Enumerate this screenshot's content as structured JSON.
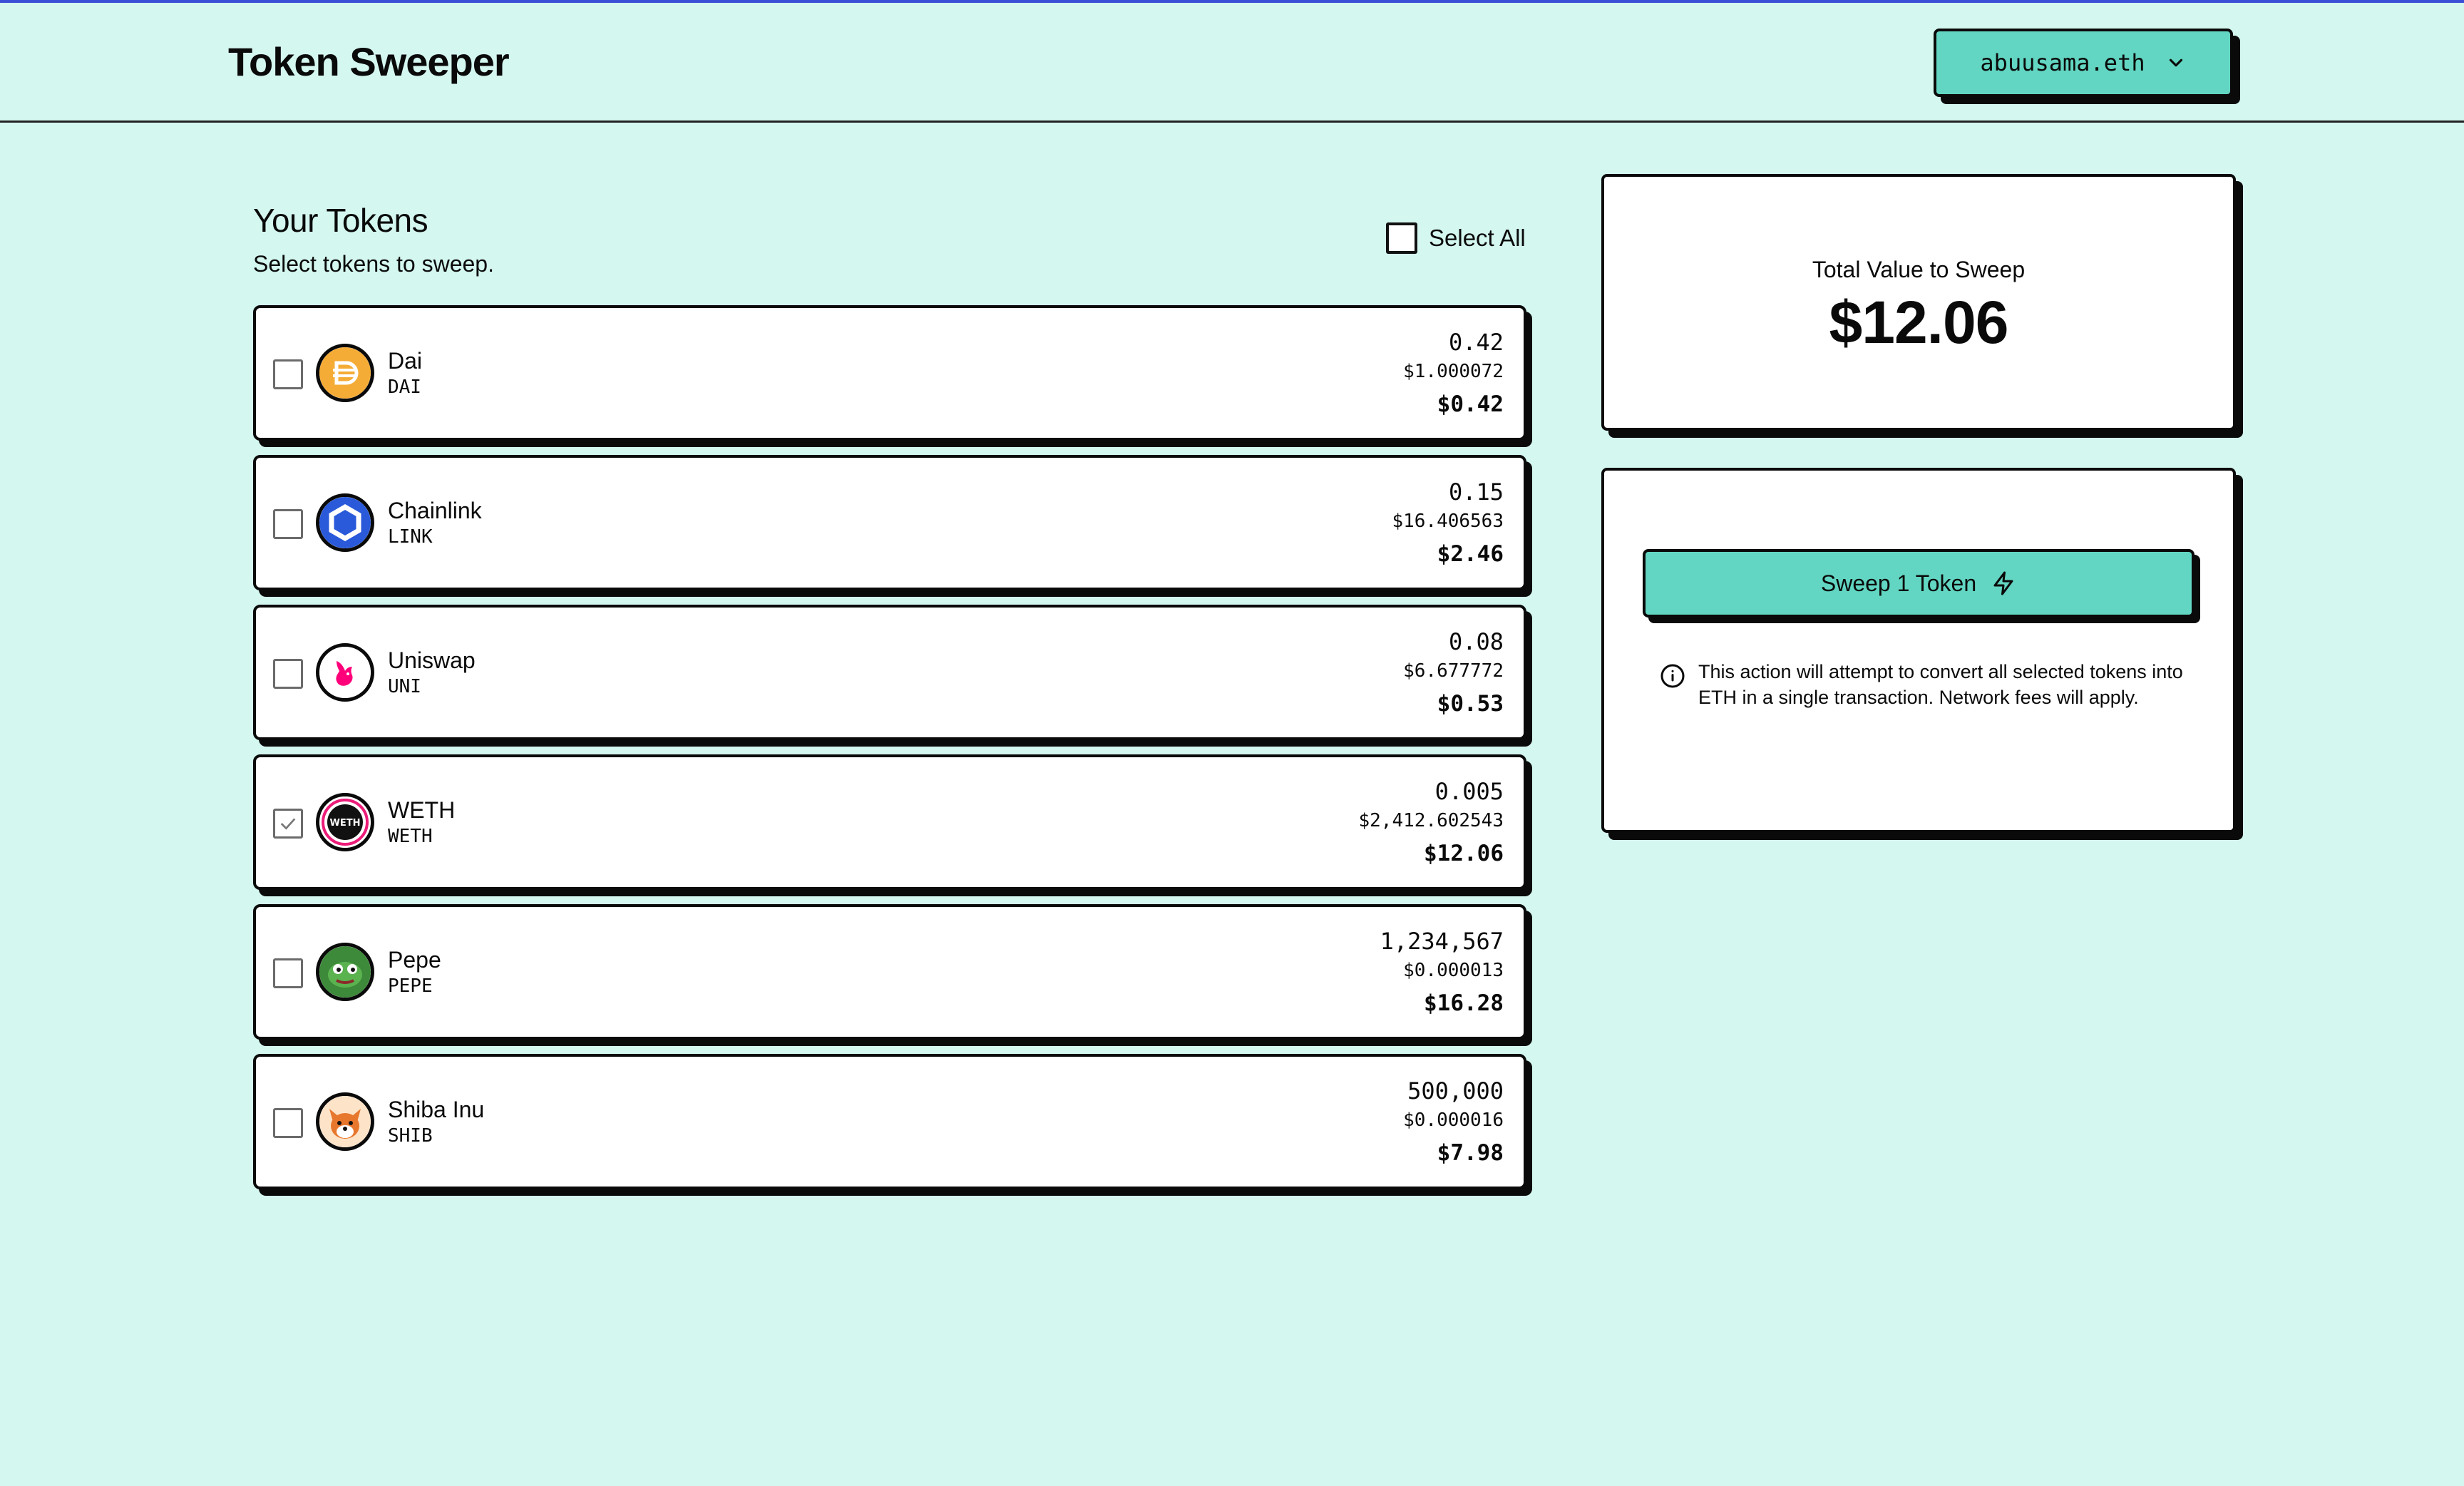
{
  "header": {
    "title": "Token Sweeper",
    "wallet": "abuusama.eth"
  },
  "tokens_section": {
    "title": "Your Tokens",
    "subtitle": "Select tokens to sweep.",
    "select_all_label": "Select All"
  },
  "tokens": [
    {
      "name": "Dai",
      "symbol": "DAI",
      "balance": "0.42",
      "price": "$1.000072",
      "value": "$0.42",
      "selected": false,
      "icon": "dai-icon"
    },
    {
      "name": "Chainlink",
      "symbol": "LINK",
      "balance": "0.15",
      "price": "$16.406563",
      "value": "$2.46",
      "selected": false,
      "icon": "chainlink-icon"
    },
    {
      "name": "Uniswap",
      "symbol": "UNI",
      "balance": "0.08",
      "price": "$6.677772",
      "value": "$0.53",
      "selected": false,
      "icon": "uniswap-icon"
    },
    {
      "name": "WETH",
      "symbol": "WETH",
      "balance": "0.005",
      "price": "$2,412.602543",
      "value": "$12.06",
      "selected": true,
      "icon": "weth-icon"
    },
    {
      "name": "Pepe",
      "symbol": "PEPE",
      "balance": "1,234,567",
      "price": "$0.000013",
      "value": "$16.28",
      "selected": false,
      "icon": "pepe-icon"
    },
    {
      "name": "Shiba Inu",
      "symbol": "SHIB",
      "balance": "500,000",
      "price": "$0.000016",
      "value": "$7.98",
      "selected": false,
      "icon": "shiba-inu-icon"
    }
  ],
  "summary": {
    "total_label": "Total Value to Sweep",
    "total_value": "$12.06"
  },
  "action": {
    "sweep_label": "Sweep 1 Token",
    "info_text": "This action will attempt to convert all selected tokens into ETH in a single transaction. Network fees will apply."
  },
  "colors": {
    "background": "#d4f7f0",
    "accent": "#62d6c2",
    "border": "#0a0a0a",
    "top_line": "#3a4fd6"
  }
}
